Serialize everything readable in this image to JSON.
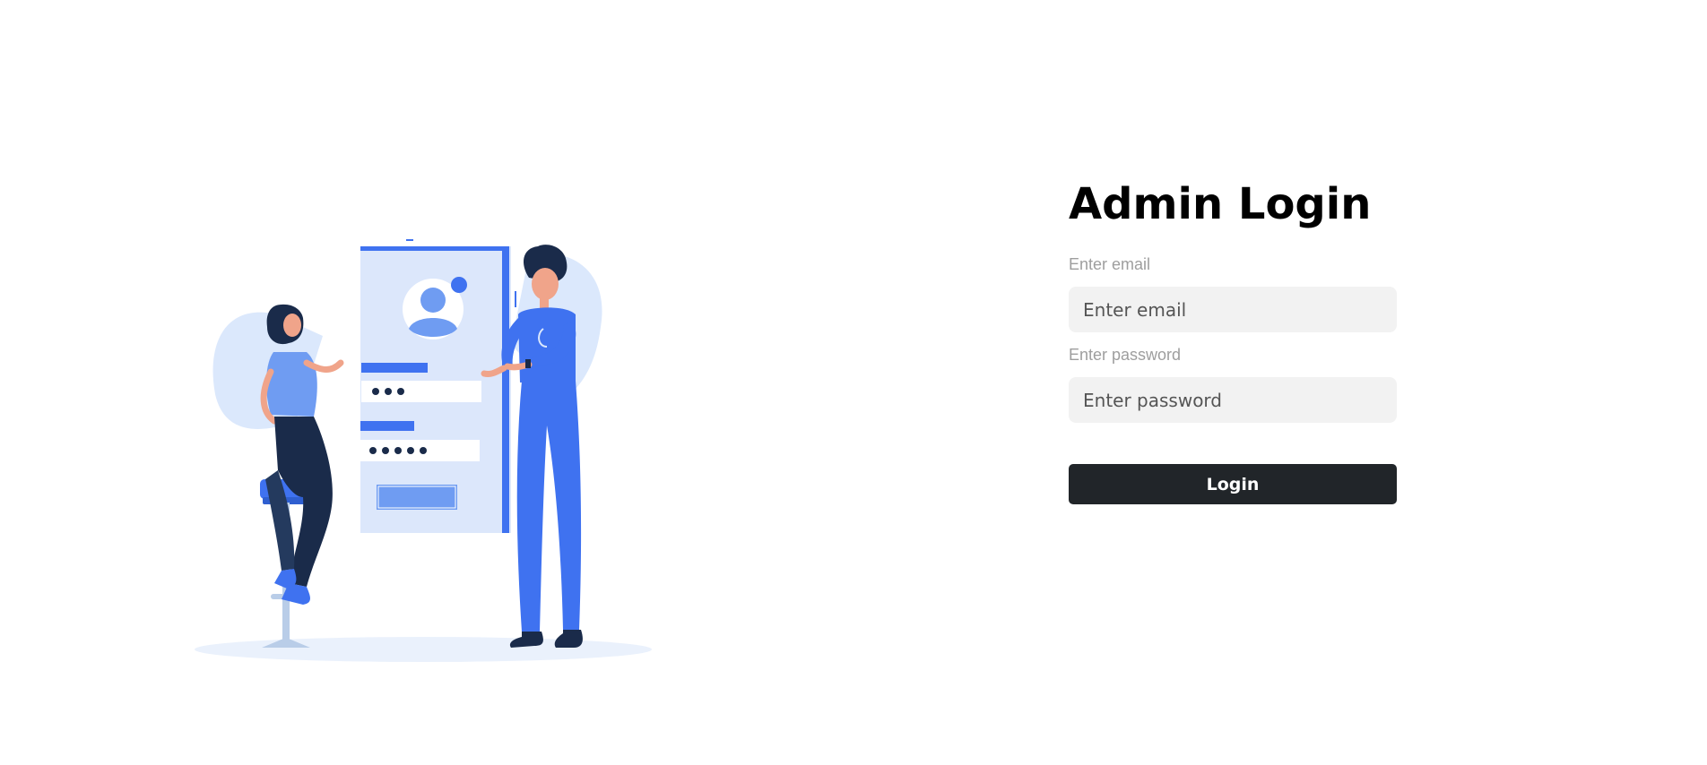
{
  "login": {
    "title": "Admin Login",
    "email_label": "Enter email",
    "email_placeholder": "Enter email",
    "email_value": "",
    "password_label": "Enter password",
    "password_placeholder": "Enter password",
    "password_value": "",
    "submit_label": "Login"
  },
  "illustration": {
    "icon": "login-illustration-icon",
    "colors": {
      "blue": "#3f72f0",
      "light_blue": "#d6e4fb",
      "navy": "#1a2b4a",
      "button_dark": "#212529"
    }
  }
}
